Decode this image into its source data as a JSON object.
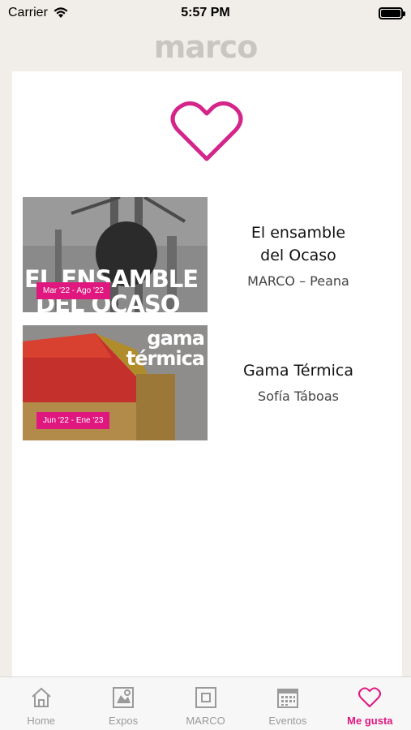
{
  "status": {
    "carrier": "Carrier",
    "time": "5:57 PM"
  },
  "brand": {
    "logo_text": "marco",
    "accent_color": "#e0177f"
  },
  "favorites_header_icon": "heart-icon",
  "items": [
    {
      "title_line1": "El ensamble",
      "title_line2": "del Ocaso",
      "subtitle": "MARCO – Peana",
      "thumb_text_line1": "EL ENSAMBLE",
      "thumb_text_line2": "DEL OCASO",
      "date_badge": "Mar '22 - Ago '22"
    },
    {
      "title_line1": "Gama Térmica",
      "subtitle": "Sofía Táboas",
      "thumb_text_line1": "gama",
      "thumb_text_line2": "térmica",
      "date_badge": "Jun '22 - Ene '23"
    }
  ],
  "tabs": [
    {
      "label": "Home",
      "icon": "home-icon",
      "active": false
    },
    {
      "label": "Expos",
      "icon": "expos-icon",
      "active": false
    },
    {
      "label": "MARCO",
      "icon": "marco-icon",
      "active": false
    },
    {
      "label": "Eventos",
      "icon": "calendar-icon",
      "active": false
    },
    {
      "label": "Me gusta",
      "icon": "heart-icon",
      "active": true
    }
  ]
}
